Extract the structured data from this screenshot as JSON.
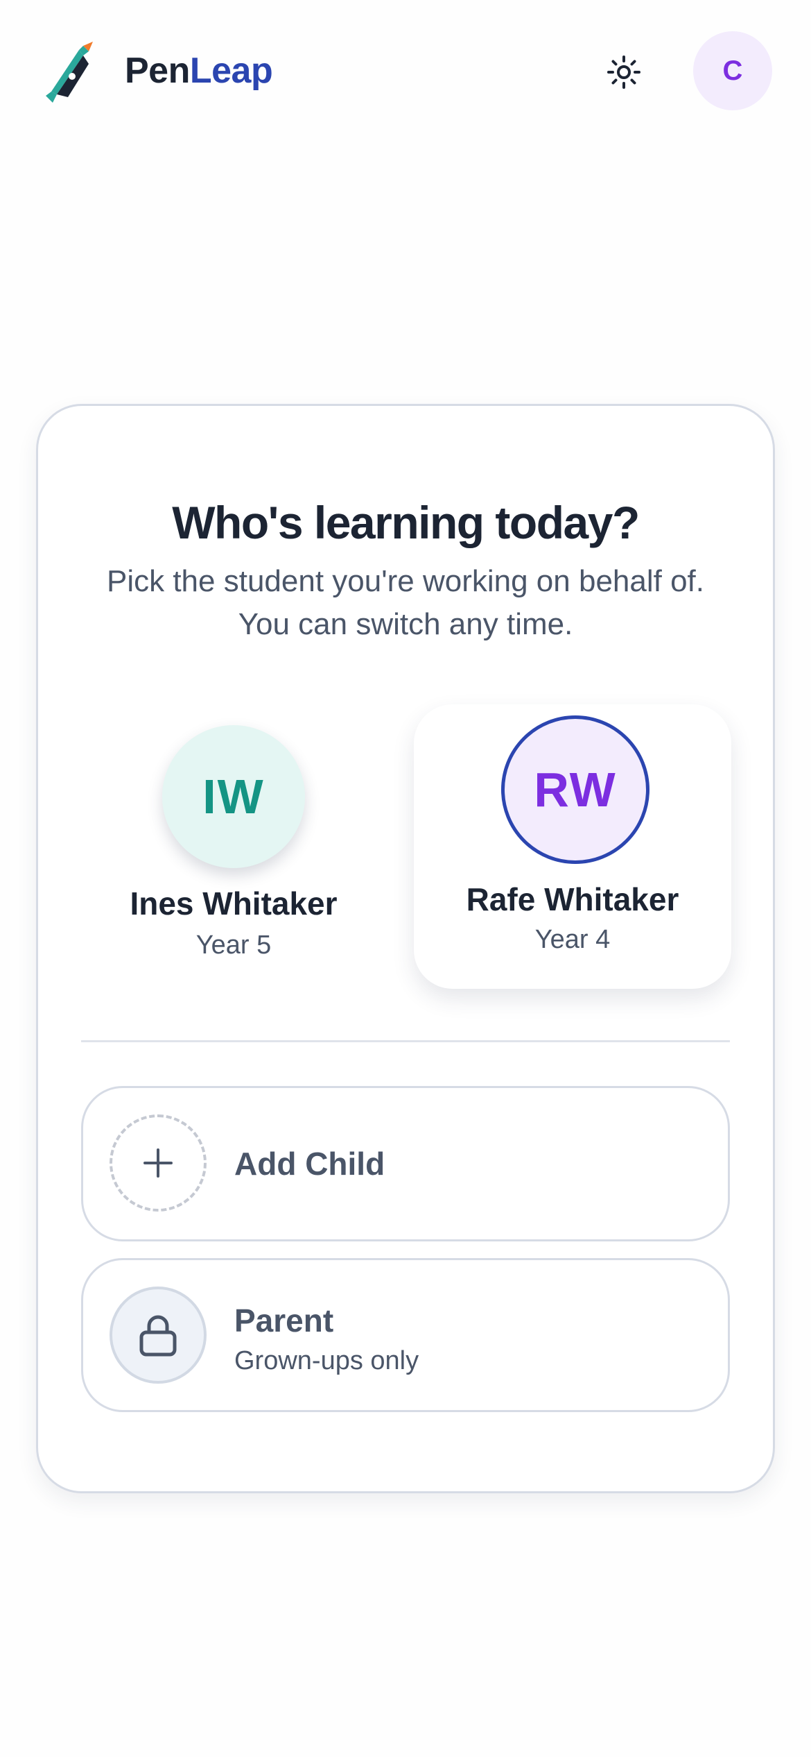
{
  "header": {
    "brand_part1": "Pen",
    "brand_part2": "Leap",
    "theme_icon": "sun-icon",
    "avatar_initial": "C"
  },
  "card": {
    "title": "Who's learning today?",
    "subtitle": "Pick the student you're working on behalf of. You can switch any time."
  },
  "students": [
    {
      "initials": "IW",
      "name": "Ines Whitaker",
      "year": "Year 5",
      "color": "#149484",
      "selected": false
    },
    {
      "initials": "RW",
      "name": "Rafe Whitaker",
      "year": "Year 4",
      "color": "#7c2ee0",
      "selected": true
    }
  ],
  "add_child": {
    "label": "Add Child",
    "icon": "plus-icon"
  },
  "parent": {
    "label": "Parent",
    "sub": "Grown-ups only",
    "icon": "lock-icon"
  },
  "colors": {
    "brand_dark": "#1c2433",
    "brand_accent": "#2b45b0",
    "purple": "#7c2ee0",
    "teal": "#149484"
  }
}
